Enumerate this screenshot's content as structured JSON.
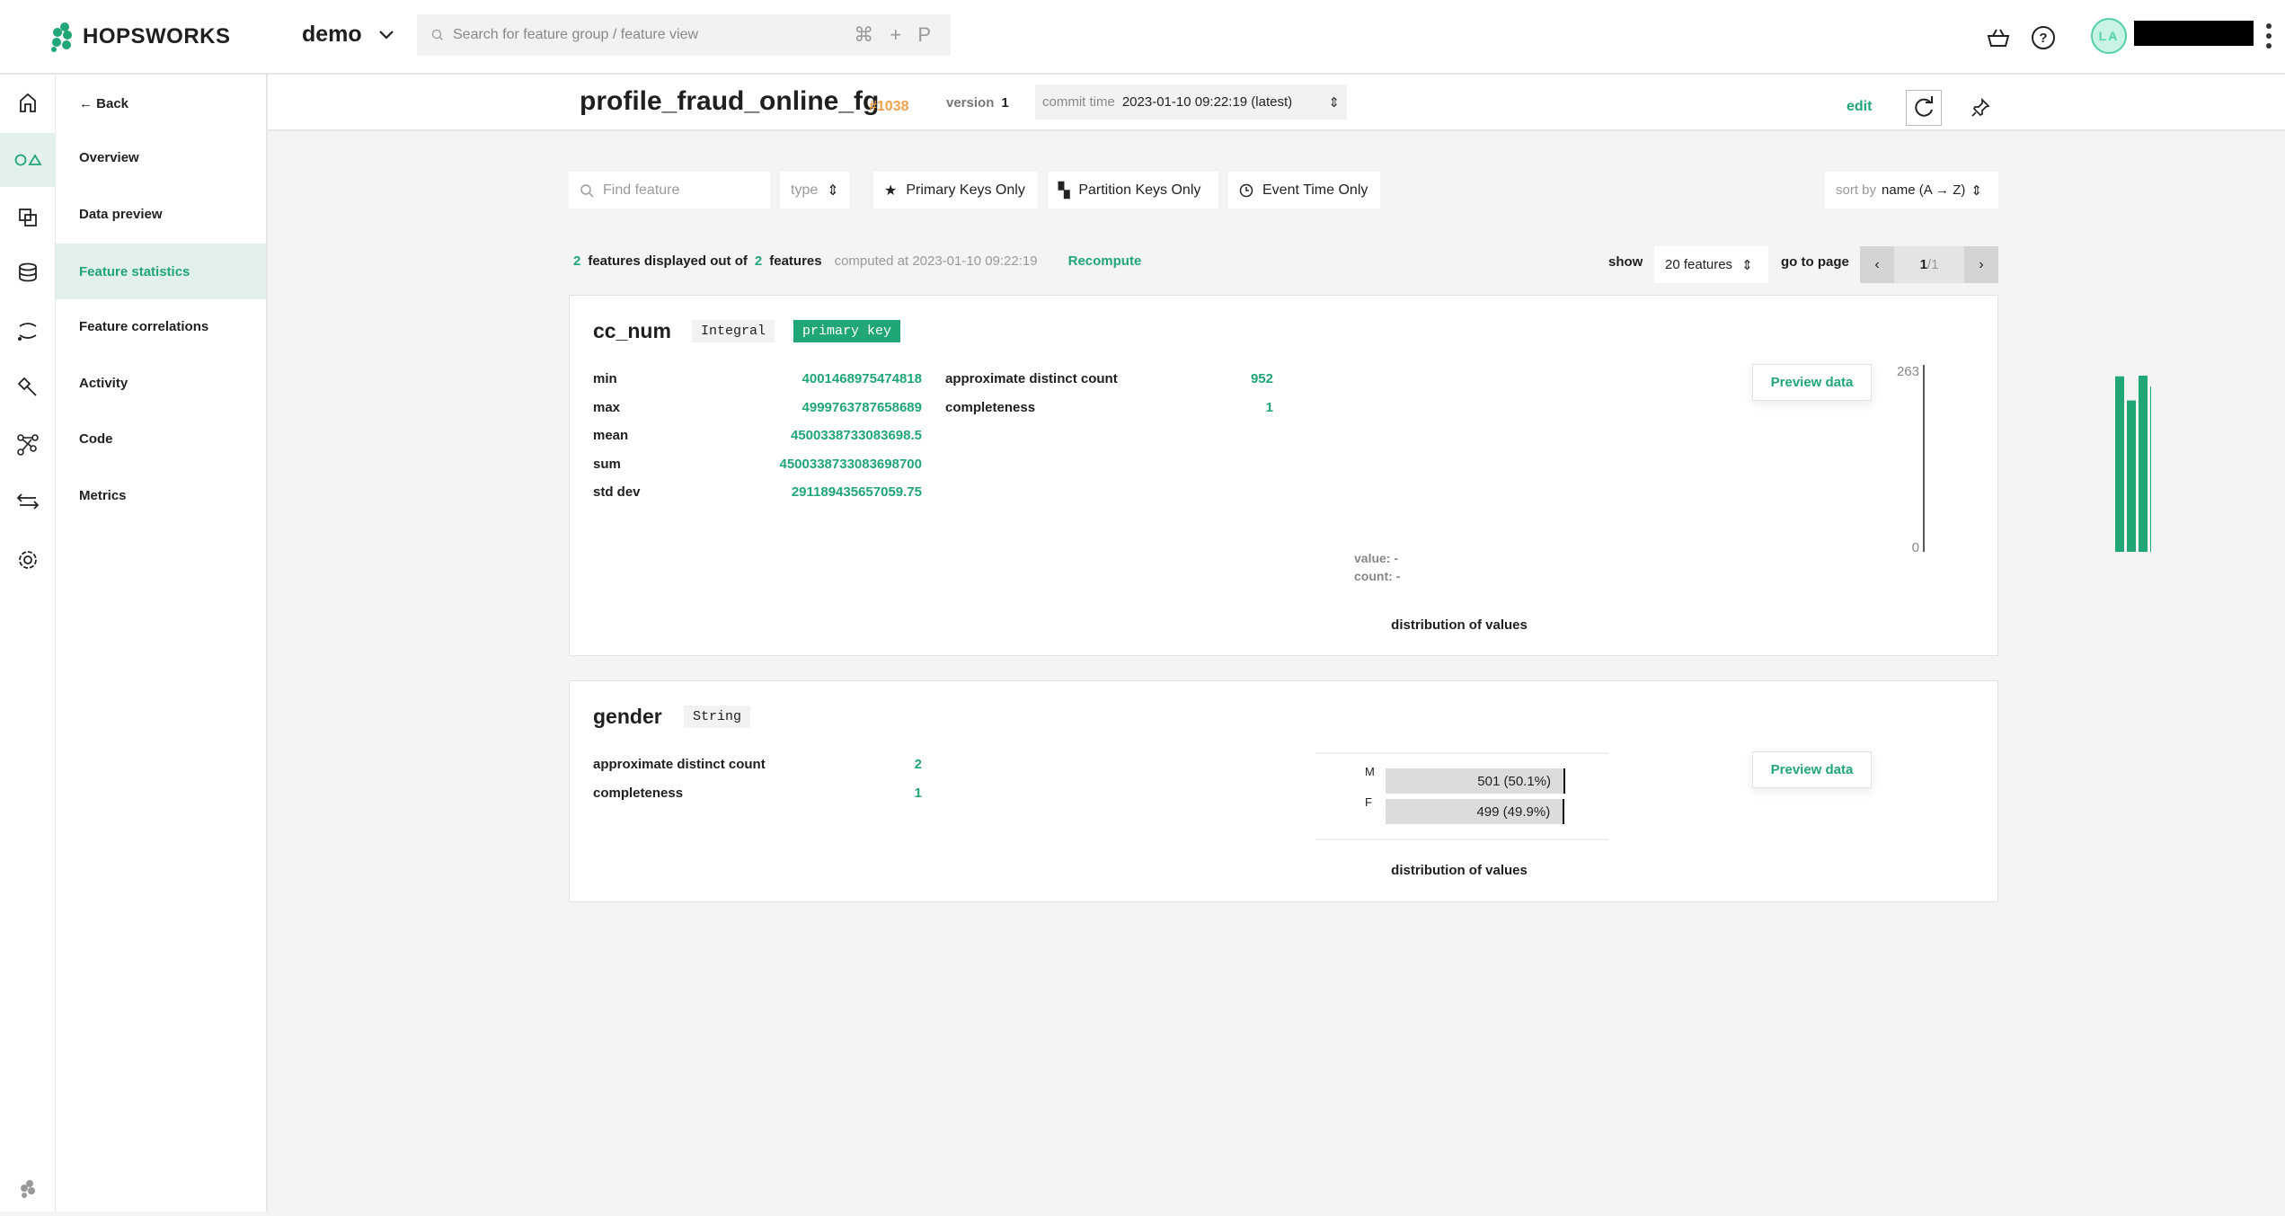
{
  "topbar": {
    "brand": "HOPSWORKS",
    "project": "demo",
    "search_placeholder": "Search for feature group / feature view",
    "search_shortcut": "⌘ + P",
    "avatar_initials": "LA"
  },
  "rail": {
    "icons": [
      "home-icon",
      "feature-store-icon",
      "feature-views-icon",
      "database-icon",
      "pipelines-icon",
      "hammer-icon",
      "model-graph-icon",
      "transfer-icon",
      "settings-icon"
    ],
    "active": 1
  },
  "sidebar": {
    "back": "← Back",
    "items": [
      {
        "label": "Overview"
      },
      {
        "label": "Data preview"
      },
      {
        "label": "Feature statistics",
        "active": true
      },
      {
        "label": "Feature correlations"
      },
      {
        "label": "Activity"
      },
      {
        "label": "Code"
      },
      {
        "label": "Metrics"
      }
    ]
  },
  "header": {
    "title": "profile_fraud_online_fg",
    "id": "#1038",
    "version_label": "version",
    "version": "1",
    "commit_label": "commit time",
    "commit_value": "2023-01-10 09:22:19 (latest)",
    "edit": "edit"
  },
  "filters": {
    "find_placeholder": "Find feature",
    "type": "type",
    "primary": "Primary Keys Only",
    "partition": "Partition Keys Only",
    "event": "Event Time Only",
    "sort_label": "sort by",
    "sort_value": "name (A → Z)"
  },
  "summary": {
    "displayed": "2",
    "text1": "features displayed out of",
    "total": "2",
    "text2": "features",
    "computed": "computed at 2023-01-10 09:22:19",
    "recompute": "Recompute",
    "show": "show",
    "show_value": "20 features",
    "goto": "go to page",
    "page": "1",
    "pages": "/1"
  },
  "colors": {
    "accent": "#21a675",
    "id": "#f0a24b"
  },
  "features": [
    {
      "name": "cc_num",
      "type": "Integral",
      "badge": "primary key",
      "stats": [
        {
          "label": "min",
          "value": "4001468975474818"
        },
        {
          "label": "max",
          "value": "4999763787658689"
        },
        {
          "label": "mean",
          "value": "4500338733083698.5"
        },
        {
          "label": "sum",
          "value": "4500338733083698700"
        },
        {
          "label": "std dev",
          "value": "291189435657059.75"
        }
      ],
      "stats2": [
        {
          "label": "approximate distinct count",
          "value": "952"
        },
        {
          "label": "completeness",
          "value": "1"
        }
      ],
      "preview": "Preview data",
      "dist_label": "distribution of values",
      "value_label": "value: -",
      "count_label": "count: -"
    },
    {
      "name": "gender",
      "type": "String",
      "stats": [
        {
          "label": "approximate distinct count",
          "value": "2"
        },
        {
          "label": "completeness",
          "value": "1"
        }
      ],
      "preview": "Preview data",
      "dist_label": "distribution of values"
    }
  ],
  "chart_data": [
    {
      "type": "bar",
      "title": "",
      "ylim": [
        0,
        263
      ],
      "yticks": [
        "263",
        "0"
      ],
      "values": [
        262,
        226,
        263,
        247
      ]
    },
    {
      "type": "bar",
      "orientation": "horizontal",
      "categories": [
        "M",
        "F"
      ],
      "values": [
        501,
        499
      ],
      "labels": [
        "501 (50.1%)",
        "499 (49.9%)"
      ]
    }
  ]
}
